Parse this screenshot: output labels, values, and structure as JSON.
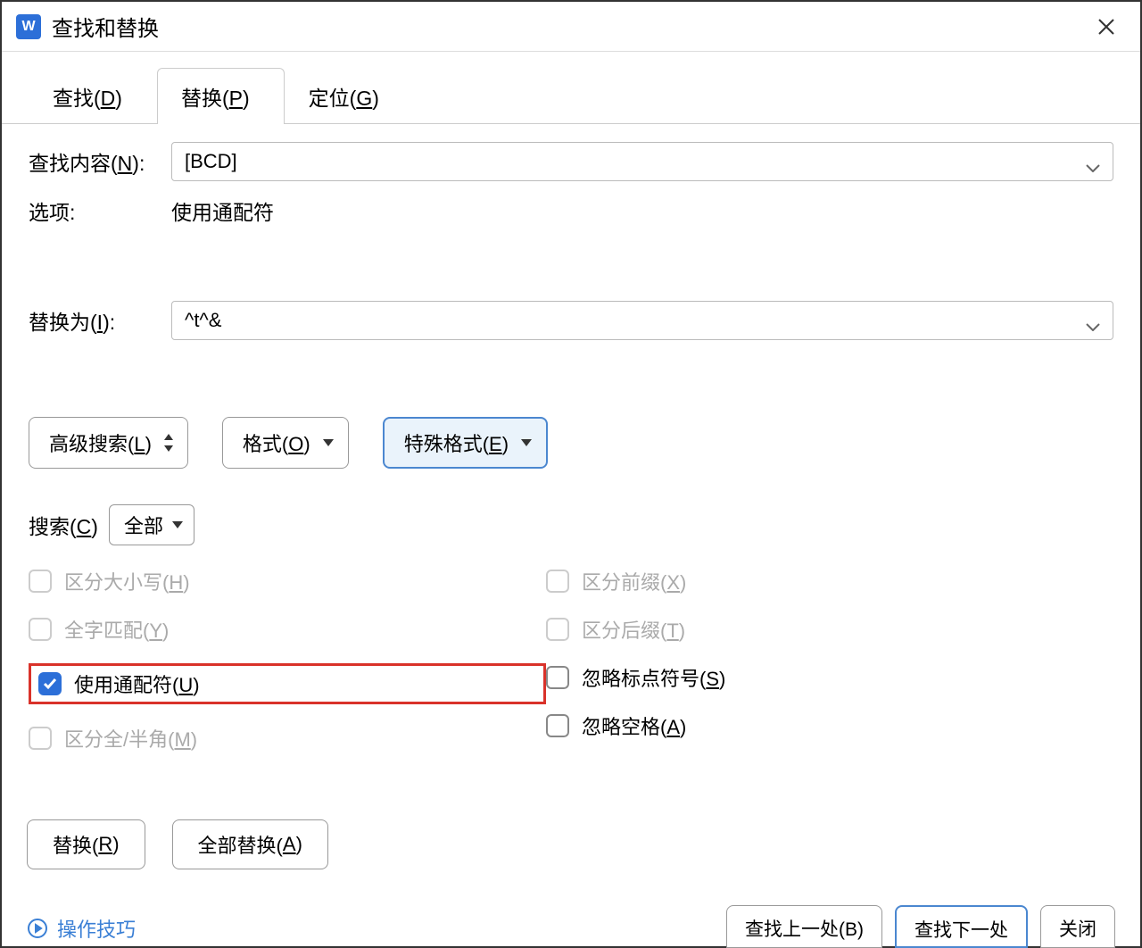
{
  "title": "查找和替换",
  "tabs": {
    "find": "查找(",
    "find_key": "D",
    "find_end": ")",
    "replace": "替换(",
    "replace_key": "P",
    "replace_end": ")",
    "goto": "定位(",
    "goto_key": "G",
    "goto_end": ")"
  },
  "fields": {
    "find_label_pre": "查找内容(",
    "find_label_key": "N",
    "find_label_post": "):",
    "find_value": "[BCD]",
    "options_label": "选项:",
    "options_value": "使用通配符",
    "replace_label_pre": "替换为(",
    "replace_label_key": "I",
    "replace_label_post": "):",
    "replace_value": "^t^&"
  },
  "buttons": {
    "advanced_pre": "高级搜索(",
    "advanced_key": "L",
    "advanced_post": ")",
    "format_pre": "格式(",
    "format_key": "O",
    "format_post": ")",
    "special_pre": "特殊格式(",
    "special_key": "E",
    "special_post": ")"
  },
  "scope": {
    "label_pre": "搜索(",
    "label_key": "C",
    "label_post": ")",
    "value": "全部"
  },
  "checkboxes": {
    "left": [
      {
        "txt": "区分大小写(",
        "key": "H",
        "end": ")",
        "checked": false,
        "disabled": true
      },
      {
        "txt": "全字匹配(",
        "key": "Y",
        "end": ")",
        "checked": false,
        "disabled": true
      },
      {
        "txt": "使用通配符(",
        "key": "U",
        "end": ")",
        "checked": true,
        "disabled": false,
        "highlight": true
      },
      {
        "txt": "区分全/半角(",
        "key": "M",
        "end": ")",
        "checked": false,
        "disabled": true
      }
    ],
    "right": [
      {
        "txt": "区分前缀(",
        "key": "X",
        "end": ")",
        "checked": false,
        "disabled": true
      },
      {
        "txt": "区分后缀(",
        "key": "T",
        "end": ")",
        "checked": false,
        "disabled": true
      },
      {
        "txt": "忽略标点符号(",
        "key": "S",
        "end": ")",
        "checked": false,
        "disabled": false
      },
      {
        "txt": "忽略空格(",
        "key": "A",
        "end": ")",
        "checked": false,
        "disabled": false
      }
    ]
  },
  "bottom_buttons": {
    "replace_pre": "替换(",
    "replace_key": "R",
    "replace_post": ")",
    "replace_all_pre": "全部替换(",
    "replace_all_key": "A",
    "replace_all_post": ")"
  },
  "partial": {
    "tips": "操作技巧",
    "find_prev": "查找上一处(B)",
    "find_next": "查找下一处",
    "close": "关闭"
  }
}
